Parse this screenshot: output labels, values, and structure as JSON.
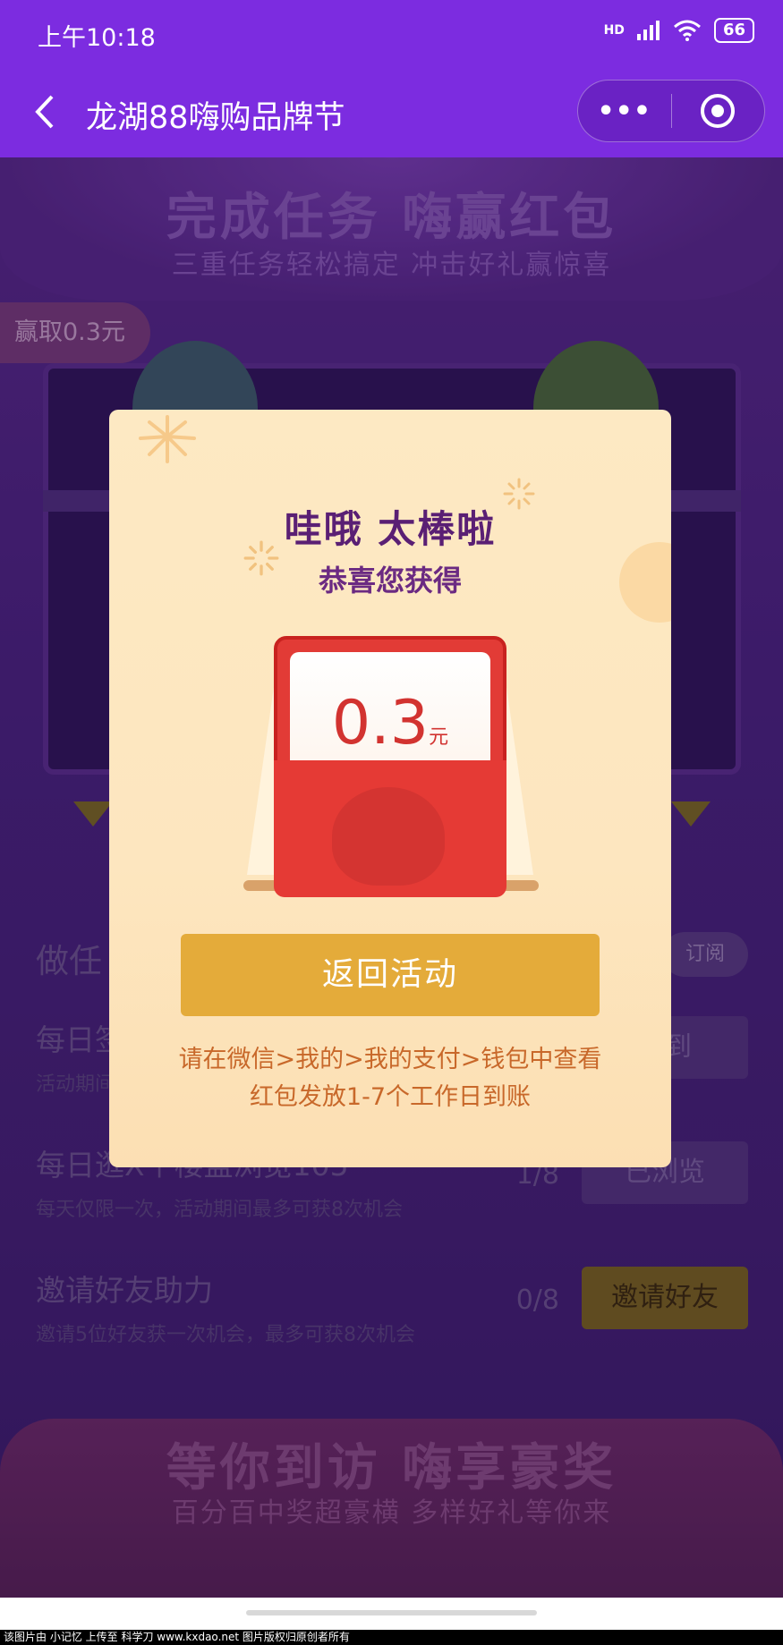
{
  "status_bar": {
    "time": "上午10:18",
    "network": "HD",
    "battery": "66"
  },
  "nav": {
    "title": "龙湖88嗨购品牌节",
    "more_label": "•••"
  },
  "background_page": {
    "banner_title": "完成任务 嗨赢红包",
    "banner_subtitle": "三重任务轻松搞定 冲击好礼赢惊喜",
    "win_badge": "赢取0.3元",
    "task_section_title": "做任",
    "subscribe_label": "订阅",
    "tasks": [
      {
        "title": "每日签",
        "desc": "活动期间",
        "count": "",
        "button": "签到"
      },
      {
        "title": "每日逛X个楼盘浏览105",
        "desc": "每天仅限一次，活动期间最多可获8次机会",
        "count": "1/8",
        "button": "已浏览"
      },
      {
        "title": "邀请好友助力",
        "desc": "邀请5位好友获一次机会，最多可获8次机会",
        "count": "0/8",
        "button": "邀请好友"
      }
    ],
    "bottom_banner_title": "等你到访 嗨享豪奖",
    "bottom_banner_subtitle": "百分百中奖超豪横 多样好礼等你来"
  },
  "modal": {
    "title": "哇哦  太棒啦",
    "subtitle": "恭喜您获得",
    "amount": "0.3",
    "unit": "元",
    "return_button": "返回活动",
    "note_line1": "请在微信>我的>我的支付>钱包中查看",
    "note_line2": "红包发放1-7个工作日到账"
  },
  "watermark": "该图片由 小记忆 上传至 科学刀 www.kxdao.net 图片版权归原创者所有",
  "colors": {
    "nav_bg": "#7c2ce0",
    "modal_bg": "#fde9c3",
    "return_button": "#e4ab3a",
    "envelope_red": "#e23b36",
    "title_purple": "#5a1f74",
    "note_orange": "#c8682a"
  }
}
